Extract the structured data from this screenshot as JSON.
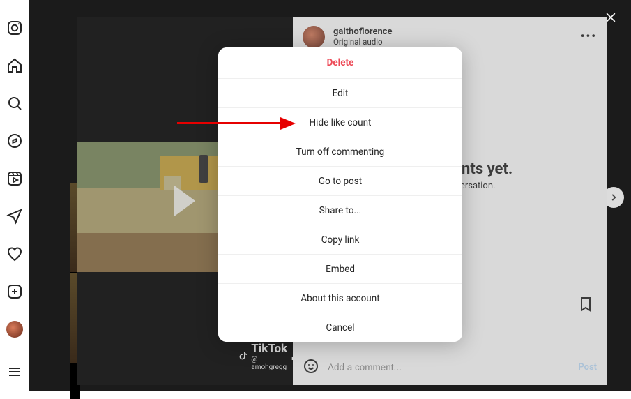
{
  "post": {
    "username": "gaithoflorence",
    "audio_label": "Original audio",
    "more_dots": "•••",
    "tiktok_label": "TikTok",
    "tiktok_handle": "@ amohgregg",
    "no_comments_heading": "No comments yet.",
    "no_comments_sub": "Start the conversation.",
    "comment_placeholder": "Add a comment...",
    "post_button": "Post"
  },
  "options": {
    "delete": "Delete",
    "edit": "Edit",
    "hide_like_count": "Hide like count",
    "turn_off_commenting": "Turn off commenting",
    "go_to_post": "Go to post",
    "share_to": "Share to...",
    "copy_link": "Copy link",
    "embed": "Embed",
    "about_account": "About this account",
    "cancel": "Cancel"
  }
}
